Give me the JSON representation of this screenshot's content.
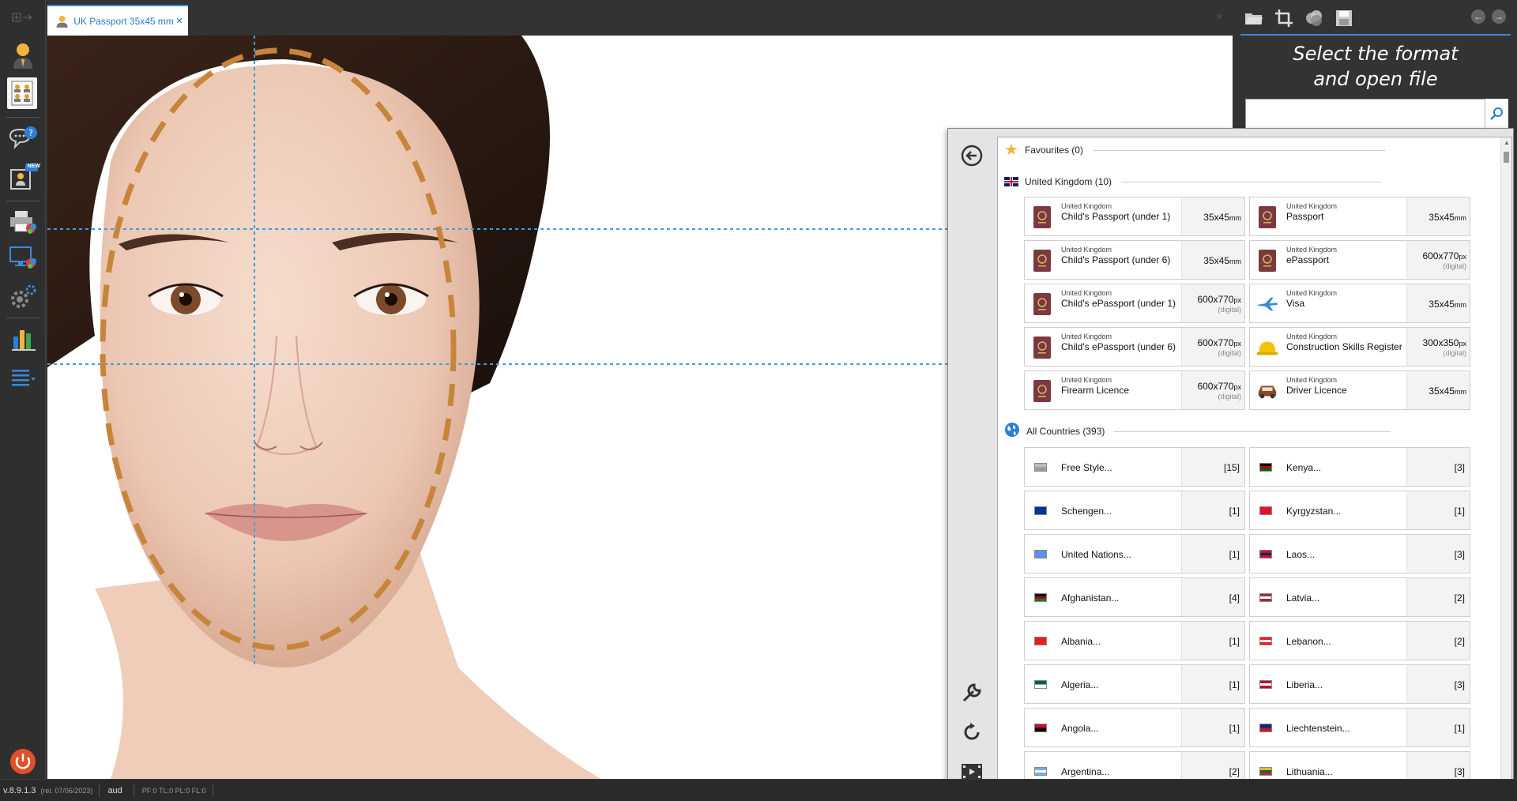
{
  "tab": {
    "title": "UK Passport 35x45 mm",
    "close": "×"
  },
  "tabbar_close": "×",
  "left_toolbar": {
    "items": [
      {
        "icon": "add-icon"
      },
      {
        "icon": "person-icon"
      },
      {
        "icon": "group-photo-icon"
      },
      {
        "icon": "help-chat-icon"
      },
      {
        "icon": "new-template-icon",
        "badge": "NEW"
      },
      {
        "icon": "print-icon"
      },
      {
        "icon": "display-icon"
      },
      {
        "icon": "settings-icon"
      },
      {
        "icon": "stats-icon"
      },
      {
        "icon": "menu-icon"
      },
      {
        "icon": "power-icon"
      }
    ]
  },
  "right_panel": {
    "title_line1": "Select the format",
    "title_line2": "and open file",
    "search": {
      "value": "",
      "placeholder": ""
    },
    "tools": [
      "open-folder-icon",
      "crop-icon",
      "color-adjust-icon",
      "save-icon"
    ],
    "nav": {
      "back": "←",
      "forward": "→"
    }
  },
  "popup": {
    "favourites": {
      "label": "Favourites (0)"
    },
    "uk": {
      "label": "United Kingdom (10)",
      "formats": [
        {
          "country": "United Kingdom",
          "name": "Child's Passport (under 1)",
          "size": "35x45",
          "unit": "mm",
          "digital": "",
          "icon": "passport-icon"
        },
        {
          "country": "United Kingdom",
          "name": "Passport",
          "size": "35x45",
          "unit": "mm",
          "digital": "",
          "icon": "passport-icon"
        },
        {
          "country": "United Kingdom",
          "name": "Child's Passport (under 6)",
          "size": "35x45",
          "unit": "mm",
          "digital": "",
          "icon": "passport-icon"
        },
        {
          "country": "United Kingdom",
          "name": "ePassport",
          "size": "600x770",
          "unit": "px",
          "digital": "(digital)",
          "icon": "passport-icon"
        },
        {
          "country": "United Kingdom",
          "name": "Child's ePassport (under 1)",
          "size": "600x770",
          "unit": "px",
          "digital": "(digital)",
          "icon": "passport-icon"
        },
        {
          "country": "United Kingdom",
          "name": "Visa",
          "size": "35x45",
          "unit": "mm",
          "digital": "",
          "icon": "airplane-icon"
        },
        {
          "country": "United Kingdom",
          "name": "Child's ePassport (under 6)",
          "size": "600x770",
          "unit": "px",
          "digital": "(digital)",
          "icon": "passport-icon"
        },
        {
          "country": "United Kingdom",
          "name": "Construction Skills Register",
          "size": "300x350",
          "unit": "px",
          "digital": "(digital)",
          "icon": "hard-hat-icon"
        },
        {
          "country": "United Kingdom",
          "name": "Firearm Licence",
          "size": "600x770",
          "unit": "px",
          "digital": "(digital)",
          "icon": "passport-icon"
        },
        {
          "country": "United Kingdom",
          "name": "Driver Licence",
          "size": "35x45",
          "unit": "mm",
          "digital": "",
          "icon": "car-icon"
        }
      ]
    },
    "all": {
      "label": "All Countries (393)",
      "countries": [
        {
          "name": "Free Style...",
          "count": "[15]",
          "flag": [
            "#bbb",
            "#999"
          ]
        },
        {
          "name": "Kenya...",
          "count": "[3]",
          "flag": [
            "#000",
            "#b00",
            "#060"
          ]
        },
        {
          "name": "Schengen...",
          "count": "[1]",
          "flag": [
            "#039",
            "#039"
          ]
        },
        {
          "name": "Kyrgyzstan...",
          "count": "[1]",
          "flag": [
            "#e8112d",
            "#e8112d"
          ]
        },
        {
          "name": "United Nations...",
          "count": "[1]",
          "flag": [
            "#5b92e5",
            "#5b92e5"
          ]
        },
        {
          "name": "Laos...",
          "count": "[3]",
          "flag": [
            "#ce1126",
            "#002868",
            "#ce1126"
          ]
        },
        {
          "name": "Afghanistan...",
          "count": "[4]",
          "flag": [
            "#000",
            "#be0000",
            "#007a36"
          ]
        },
        {
          "name": "Latvia...",
          "count": "[2]",
          "flag": [
            "#9e3039",
            "#fff",
            "#9e3039"
          ]
        },
        {
          "name": "Albania...",
          "count": "[1]",
          "flag": [
            "#e41e20",
            "#e41e20"
          ]
        },
        {
          "name": "Lebanon...",
          "count": "[2]",
          "flag": [
            "#ed1c24",
            "#fff",
            "#ed1c24"
          ]
        },
        {
          "name": "Algeria...",
          "count": "[1]",
          "flag": [
            "#006233",
            "#fff"
          ]
        },
        {
          "name": "Liberia...",
          "count": "[3]",
          "flag": [
            "#bf0a30",
            "#fff",
            "#bf0a30"
          ]
        },
        {
          "name": "Angola...",
          "count": "[1]",
          "flag": [
            "#cc092f",
            "#000"
          ]
        },
        {
          "name": "Liechtenstein...",
          "count": "[1]",
          "flag": [
            "#002b7f",
            "#ce1126"
          ]
        },
        {
          "name": "Argentina...",
          "count": "[2]",
          "flag": [
            "#74acdf",
            "#fff",
            "#74acdf"
          ]
        },
        {
          "name": "Lithuania...",
          "count": "[3]",
          "flag": [
            "#fdb913",
            "#006a44",
            "#c1272d"
          ]
        }
      ]
    },
    "side_icons": [
      "back-arrow-icon",
      "wrench-icon",
      "refresh-icon",
      "video-icon"
    ]
  },
  "status_bar": {
    "version": "v.8.9.1.3",
    "release": "(rel. 07/06/2023)",
    "user": "aud",
    "flags": "PF:0 TL:0 PL:0 FL:0"
  },
  "colors": {
    "accent": "#3a8ad6",
    "oval": "#c7853b",
    "guide": "#3aa0d8"
  }
}
